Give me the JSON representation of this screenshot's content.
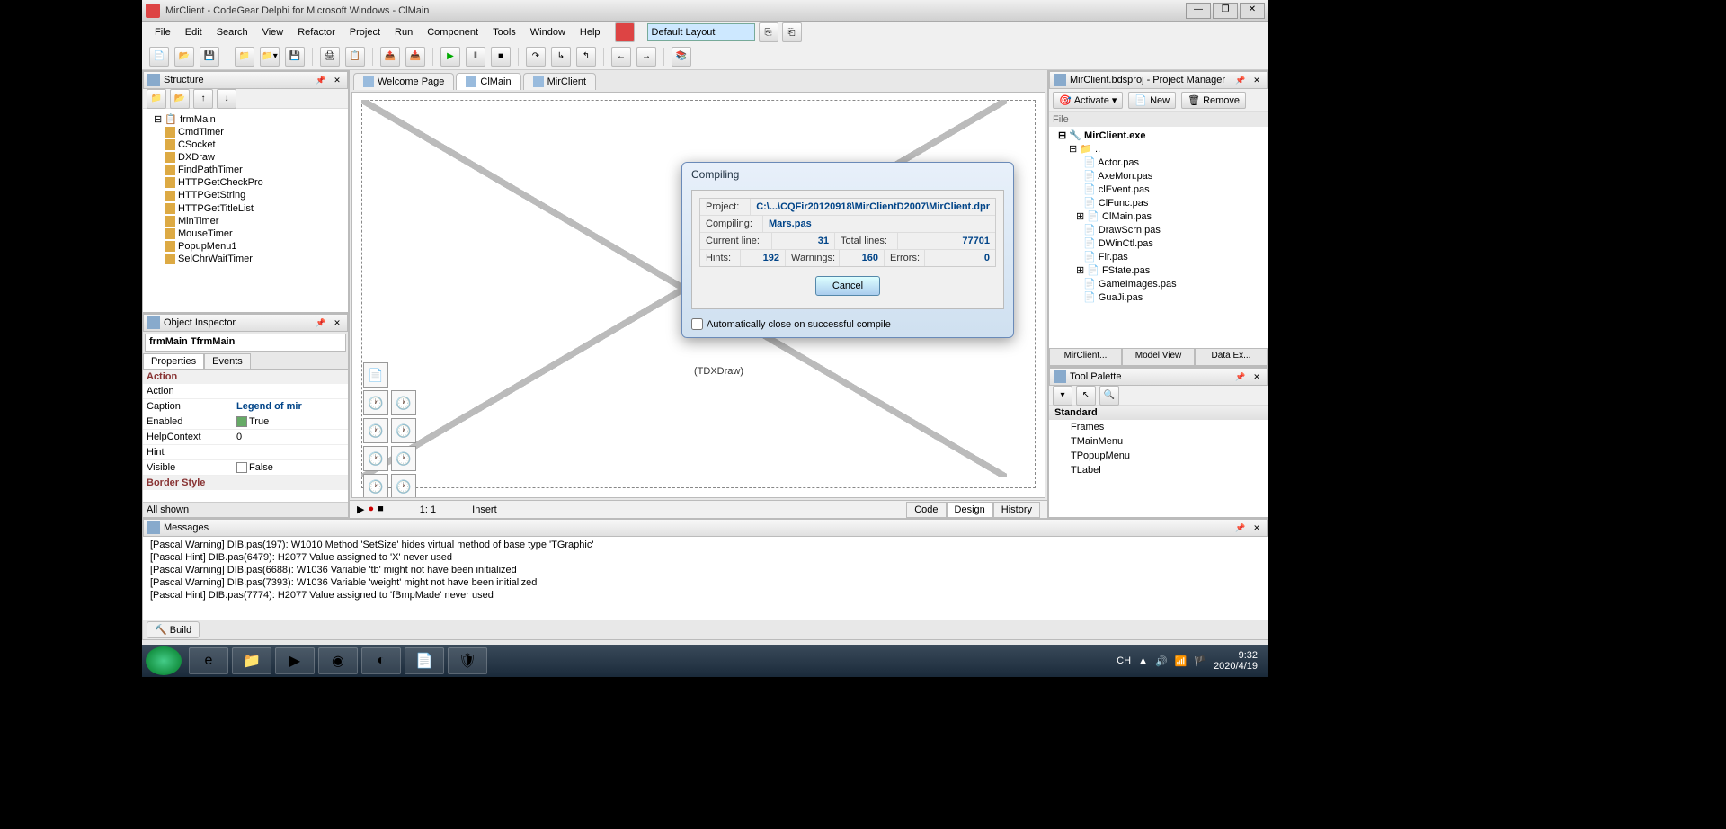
{
  "window": {
    "title": "MirClient - CodeGear Delphi for Microsoft Windows - ClMain"
  },
  "menu": [
    "File",
    "Edit",
    "Search",
    "View",
    "Refactor",
    "Project",
    "Run",
    "Component",
    "Tools",
    "Window",
    "Help"
  ],
  "layout_combo": "Default Layout",
  "structure": {
    "title": "Structure",
    "root": "frmMain",
    "items": [
      "CmdTimer",
      "CSocket",
      "DXDraw",
      "FindPathTimer",
      "HTTPGetCheckPro",
      "HTTPGetString",
      "HTTPGetTitleList",
      "MinTimer",
      "MouseTimer",
      "PopupMenu1",
      "SelChrWaitTimer"
    ]
  },
  "inspector": {
    "title": "Object Inspector",
    "object": "frmMain TfrmMain",
    "tabs": [
      "Properties",
      "Events"
    ],
    "cat1": "Action",
    "props": [
      {
        "name": "Action",
        "val": ""
      },
      {
        "name": "Caption",
        "val": "Legend of mir"
      },
      {
        "name": "Enabled",
        "val": "True",
        "check": true
      },
      {
        "name": "HelpContext",
        "val": "0"
      },
      {
        "name": "Hint",
        "val": ""
      },
      {
        "name": "Visible",
        "val": "False",
        "check": false
      }
    ],
    "cat2": "Border Style",
    "footer": "All shown"
  },
  "editor": {
    "tabs": [
      "Welcome Page",
      "ClMain",
      "MirClient"
    ],
    "dxdraw": "(TDXDraw)",
    "bottom_tabs": [
      "Code",
      "Design",
      "History"
    ]
  },
  "status": {
    "pos": "1: 1",
    "mode": "Insert"
  },
  "project_manager": {
    "title": "MirClient.bdsproj - Project Manager",
    "buttons": {
      "activate": "Activate",
      "new": "New",
      "remove": "Remove"
    },
    "file_label": "File",
    "exe": "MirClient.exe",
    "files": [
      "..",
      "Actor.pas",
      "AxeMon.pas",
      "clEvent.pas",
      "ClFunc.pas",
      "ClMain.pas",
      "DrawScrn.pas",
      "DWinCtl.pas",
      "Fir.pas",
      "FState.pas",
      "GameImages.pas",
      "GuaJi.pas"
    ],
    "tabs": [
      "MirClient...",
      "Model View",
      "Data Ex..."
    ]
  },
  "palette": {
    "title": "Tool Palette",
    "category": "Standard",
    "items": [
      "Frames",
      "TMainMenu",
      "TPopupMenu",
      "TLabel"
    ]
  },
  "dialog": {
    "title": "Compiling",
    "project_label": "Project:",
    "project_val": "C:\\...\\CQFir20120918\\MirClientD2007\\MirClient.dpr",
    "compiling_label": "Compiling:",
    "compiling_val": "Mars.pas",
    "curline_label": "Current line:",
    "curline_val": "31",
    "totlines_label": "Total lines:",
    "totlines_val": "77701",
    "hints_label": "Hints:",
    "hints_val": "192",
    "warnings_label": "Warnings:",
    "warnings_val": "160",
    "errors_label": "Errors:",
    "errors_val": "0",
    "cancel": "Cancel",
    "autoclose": "Automatically close on successful compile"
  },
  "messages": {
    "title": "Messages",
    "items": [
      "[Pascal Warning] DIB.pas(197): W1010 Method 'SetSize' hides virtual method of base type 'TGraphic'",
      "[Pascal Hint] DIB.pas(6479): H2077 Value assigned to 'X' never used",
      "[Pascal Warning] DIB.pas(6688): W1036 Variable 'tb' might not have been initialized",
      "[Pascal Warning] DIB.pas(7393): W1036 Variable 'weight' might not have been initialized",
      "[Pascal Hint] DIB.pas(7774): H2077 Value assigned to 'fBmpMade' never used"
    ],
    "build": "Build"
  },
  "taskbar": {
    "lang": "CH",
    "time": "9:32",
    "date": "2020/4/19"
  }
}
